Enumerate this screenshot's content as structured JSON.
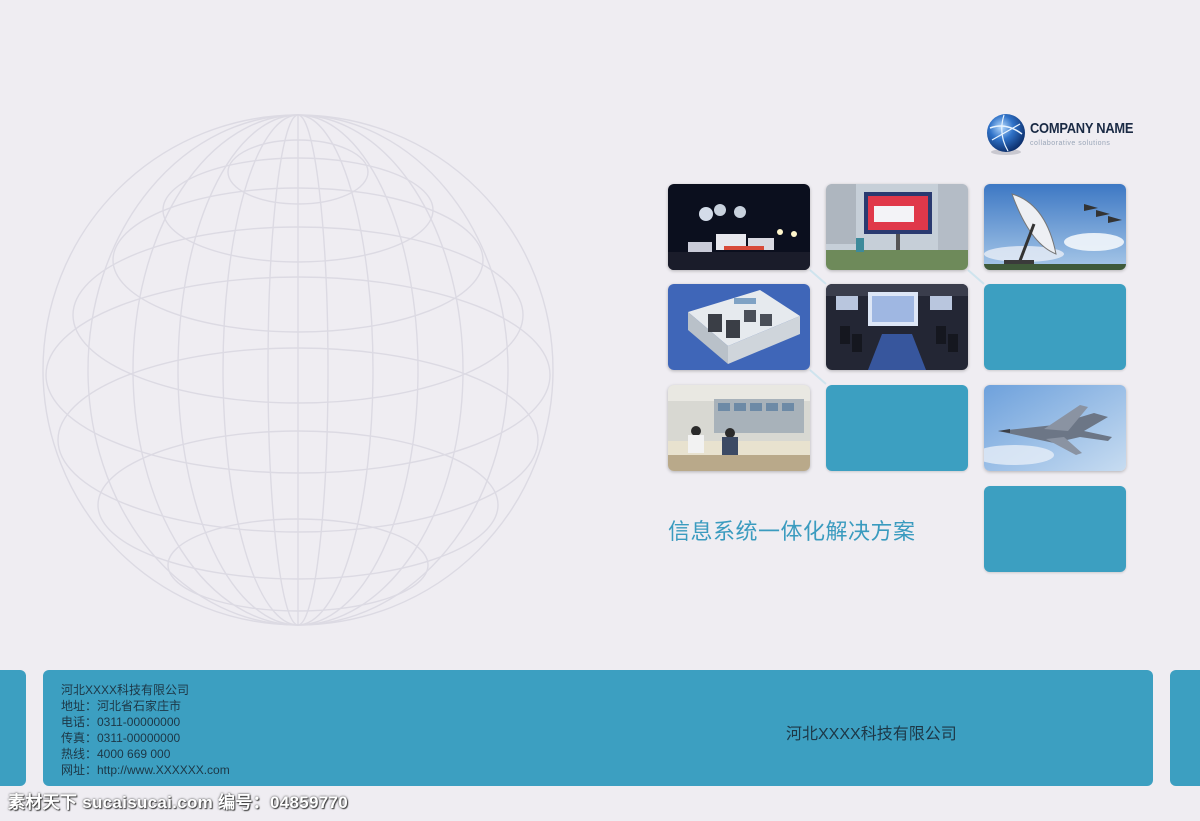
{
  "logo": {
    "name": "COMPANY NAME",
    "tagline": "collaborative solutions",
    "icon": "globe-icon"
  },
  "tiles": [
    {
      "name": "night-vehicles-photo",
      "icon": "night-emergency-vehicles-image"
    },
    {
      "name": "outdoor-led-screen-photo",
      "icon": "led-billboard-image"
    },
    {
      "name": "satellite-dish-photo",
      "icon": "satellite-dish-image"
    },
    {
      "name": "server-room-render-photo",
      "icon": "data-center-render-image"
    },
    {
      "name": "conference-room-photo",
      "icon": "video-conference-room-image"
    },
    {
      "name": "control-room-photo",
      "icon": "control-room-operators-image"
    },
    {
      "name": "fighter-jet-photo",
      "icon": "fighter-jet-image"
    }
  ],
  "main_title": "信息系统一体化解决方案",
  "footer": {
    "contact_lines": [
      "河北XXXX科技有限公司",
      "地址：河北省石家庄市",
      "电话：0311-00000000",
      "传真：0311-00000000",
      "热线：4000 669 000",
      "网址：http://www.XXXXXX.com"
    ],
    "company_name": "河北XXXX科技有限公司"
  },
  "watermark": "素材天下 sucaisucai.com  编号：04859770",
  "colors": {
    "accent": "#3c9fc1",
    "background": "#efedf2",
    "title": "#3a9bbf",
    "footer_text": "#1d3746"
  }
}
